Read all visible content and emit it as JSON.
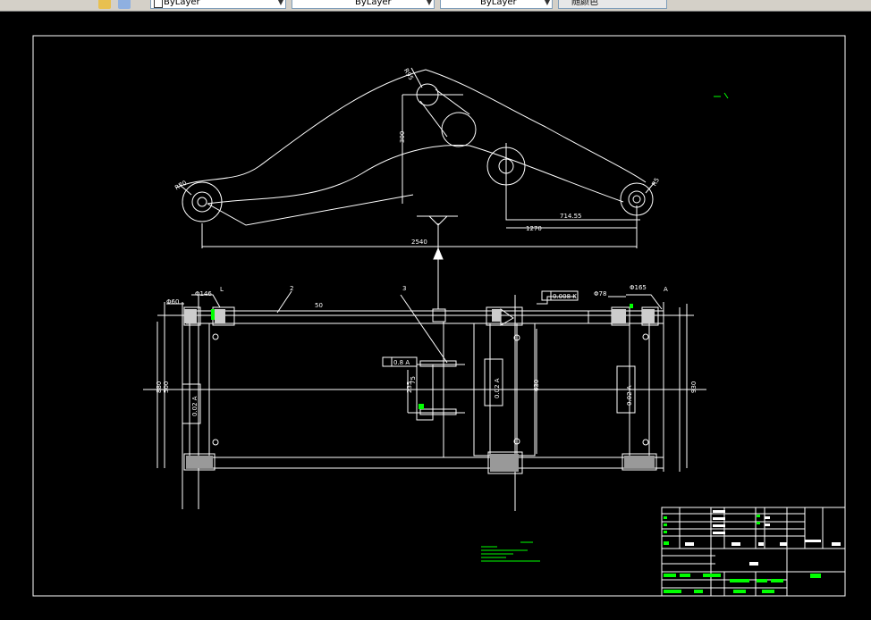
{
  "toolbar": {
    "layer_combos": [
      {
        "value": "ByLayer"
      },
      {
        "value": "ByLayer"
      },
      {
        "value": "ByLayer"
      },
      {
        "value": "随颜色"
      }
    ],
    "icons": [
      "layer-state-icon",
      "layer-props-icon"
    ]
  },
  "drawing": {
    "background": "#000000",
    "line_color": "#ffffff",
    "accent_color": "#00ff00",
    "top_view": {
      "dims": {
        "r_top": "R95",
        "height": "300",
        "r_left": "R70",
        "r_right": "R5",
        "d_right": "714.55",
        "d_mid": "1270",
        "d_total": "2540"
      }
    },
    "bottom_view": {
      "labels": {
        "left_phi1": "Φ60",
        "left_phi2": "Φ146",
        "left_ref": "L",
        "top_ref": "2",
        "dim50": "50",
        "center_ref": "3",
        "tol_tag": "0.008 K",
        "right_phi1": "Φ78",
        "right_phi2": "Φ165",
        "right_ref": "A",
        "tol_mid": "0.8 A",
        "d235": "235",
        "d75": "75",
        "d500": "500",
        "d630": "630",
        "d880": "880",
        "d930": "930",
        "left_block_tol": "0.02 A",
        "center_block_tol": "0.02 A",
        "right_block_tol": "0.02 A"
      }
    }
  }
}
